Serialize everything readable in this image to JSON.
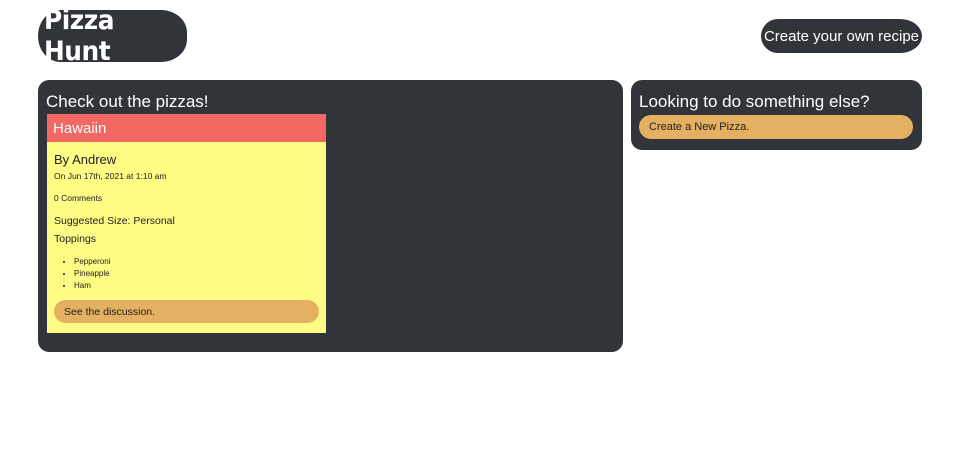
{
  "header": {
    "logo_text": "Pizza Hunt",
    "create_recipe_label": "Create your own recipe"
  },
  "main_panel": {
    "title": "Check out the pizzas!",
    "pizzas": [
      {
        "name": "Hawaiin",
        "author": "By Andrew",
        "date": "On Jun 17th, 2021 at 1:10 am",
        "comments": "0 Comments",
        "size": "Suggested Size: Personal",
        "toppings_label": "Toppings",
        "toppings": [
          "Pepperoni",
          "Pineapple",
          "Ham"
        ],
        "discussion_label": "See the discussion."
      }
    ]
  },
  "side_panel": {
    "title": "Looking to do something else?",
    "new_pizza_label": "Create a New Pizza."
  },
  "colors": {
    "panel": "#313539",
    "card": "#fffc85",
    "card_header": "#f16761",
    "button": "#e4b061"
  }
}
